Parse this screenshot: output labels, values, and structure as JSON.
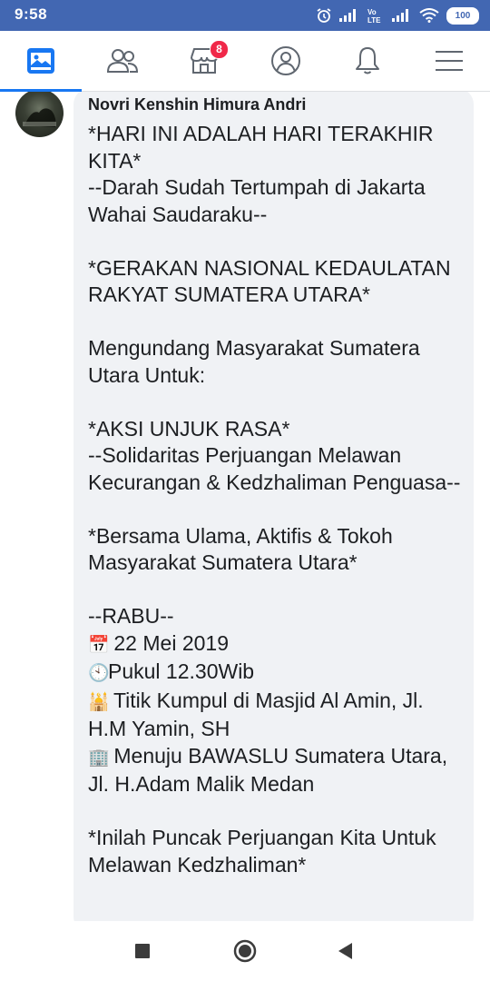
{
  "status_bar": {
    "time": "9:58",
    "battery": "100",
    "icons": [
      "alarm-icon",
      "signal-icon",
      "volte-icon",
      "signal-icon",
      "wifi-icon",
      "battery-icon"
    ]
  },
  "nav": {
    "items": [
      {
        "name": "news-feed",
        "icon": "news-feed-icon",
        "active": true
      },
      {
        "name": "friends",
        "icon": "friends-icon"
      },
      {
        "name": "marketplace",
        "icon": "marketplace-icon",
        "badge": "8"
      },
      {
        "name": "profile",
        "icon": "profile-icon"
      },
      {
        "name": "notifications",
        "icon": "bell-icon"
      },
      {
        "name": "menu",
        "icon": "hamburger-menu-icon"
      }
    ],
    "accent": "#1877f2"
  },
  "comment": {
    "author": "Novri Kenshin Himura Andri",
    "lines": [
      "*HARI INI ADALAH HARI TERAKHIR KITA*",
      "--Darah Sudah Tertumpah di Jakarta Wahai Saudaraku--",
      "",
      "*GERAKAN NASIONAL KEDAULATAN RAKYAT SUMATERA UTARA*",
      "",
      "Mengundang Masyarakat Sumatera Utara Untuk:",
      "",
      "*AKSI UNJUK RASA*",
      "--Solidaritas Perjuangan Melawan Kecurangan & Kedzhaliman Penguasa--",
      "",
      "*Bersama Ulama, Aktifis & Tokoh Masyarakat Sumatera Utara*",
      "",
      "--RABU--"
    ],
    "date": "22 Mei 2019",
    "time": "Pukul 12.30Wib",
    "gathering": "Titik Kumpul di Masjid Al Amin, Jl. H.M Yamin, SH",
    "destination": "Menuju BAWASLU Sumatera Utara, Jl. H.Adam Malik Medan",
    "closing": "*Inilah Puncak Perjuangan Kita Untuk Melawan Kedzhaliman*",
    "bubble_color": "#f0f2f5",
    "emoji": {
      "calendar": "📅",
      "clock": "🕙",
      "mosque": "🕌",
      "building": "🏢"
    }
  },
  "system_nav": {
    "buttons": [
      "recent-apps",
      "home",
      "back"
    ]
  },
  "colors": {
    "status_bar": "#4267b2",
    "badge": "#f02849"
  }
}
